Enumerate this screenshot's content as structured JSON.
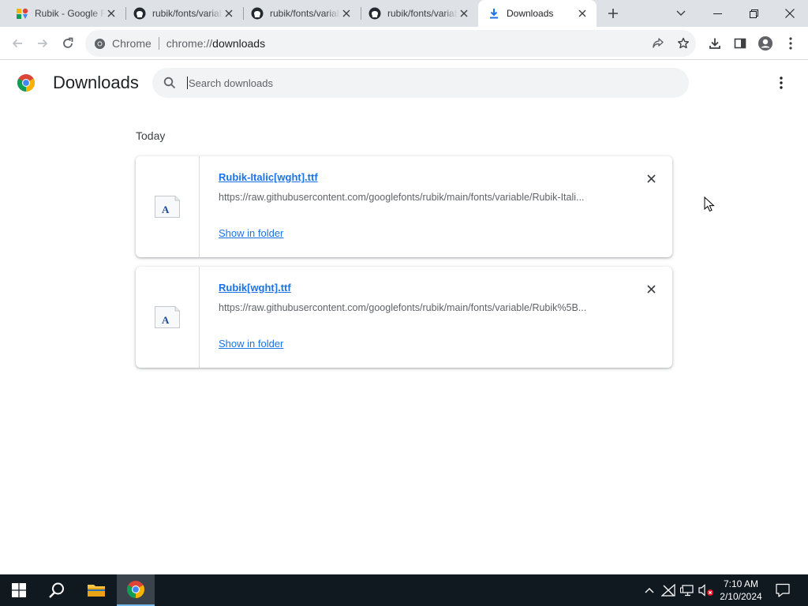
{
  "tabs": [
    {
      "title": "Rubik - Google Fonts",
      "favicon": "google-fonts-icon",
      "active": false
    },
    {
      "title": "rubik/fonts/variable at main",
      "favicon": "github-icon",
      "active": false
    },
    {
      "title": "rubik/fonts/variable at main",
      "favicon": "github-icon",
      "active": false
    },
    {
      "title": "rubik/fonts/variable at main",
      "favicon": "github-icon",
      "active": false
    },
    {
      "title": "Downloads",
      "favicon": "download-icon",
      "active": true
    }
  ],
  "omnibox": {
    "chip": "Chrome",
    "scheme": "chrome://",
    "host": "downloads"
  },
  "page": {
    "title": "Downloads",
    "search_placeholder": "Search downloads",
    "section": "Today",
    "items": [
      {
        "filename": "Rubik-Italic[wght].ttf",
        "url": "https://raw.githubusercontent.com/googlefonts/rubik/main/fonts/variable/Rubik-Itali...",
        "action": "Show in folder"
      },
      {
        "filename": "Rubik[wght].ttf",
        "url": "https://raw.githubusercontent.com/googlefonts/rubik/main/fonts/variable/Rubik%5B...",
        "action": "Show in folder"
      }
    ]
  },
  "taskbar": {
    "time": "7:10 AM",
    "date": "2/10/2024"
  },
  "colors": {
    "accent": "#1a73e8",
    "tabstrip": "#dee1e6",
    "taskbar": "#101820"
  }
}
